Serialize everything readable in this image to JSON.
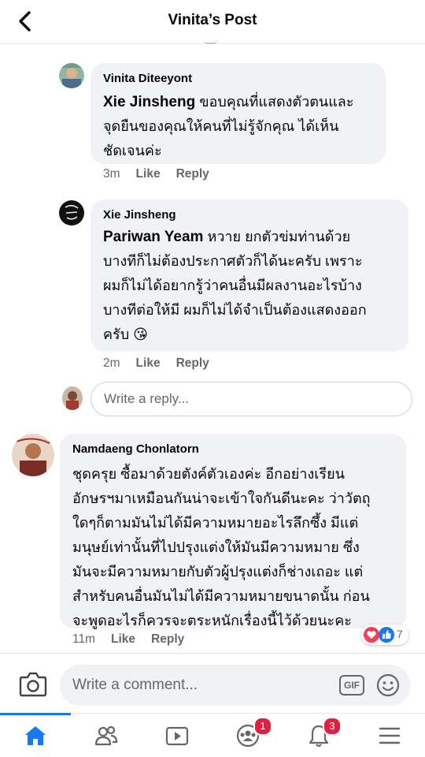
{
  "header": {
    "title": "Vinita’s Post"
  },
  "comments": [
    {
      "author": "Vinita Diteeyont",
      "mention": "Xie Jinsheng",
      "lines": [
        " ขอบคุณที่แสดงตัวตนและ",
        "จุดยืนของคุณให้คนที่ไม่รู้จักคุณ ได้เห็น",
        "ชัดเจนค่ะ"
      ],
      "time": "3m",
      "like": "Like",
      "reply": "Reply"
    },
    {
      "author": "Xie Jinsheng",
      "mention": "Pariwan Yeam",
      "lines": [
        " หวาย ยกตัวข่มท่านด้วย",
        "บางทีก็ไม่ต้องประกาศตัวก็ได้นะครับ เพราะ",
        "ผมก็ไม่ได้อยากรู้ว่าคนอื่นมีผลงานอะไรบ้าง",
        "บางทีต่อให้มี ผมก็ไม่ได้จำเป็นต้องแสดงออก",
        "ครับ 😘"
      ],
      "time": "2m",
      "like": "Like",
      "reply": "Reply"
    },
    {
      "author": "Namdaeng Chonlatorn",
      "lines": [
        "ชุดครุย ซื้อมาด้วยตังค์ตัวเองค่ะ อีกอย่างเรียน",
        "อักษรฯมาเหมือนกันน่าจะเข้าใจกันดีนะคะ ว่าวัตถุ",
        "ใดๆก็ตามมันไม่ได้มีความหมายอะไรลึกซึ้ง มีแต่",
        "มนุษย์เท่านั้นที่ไปปรุงแต่งให้มันมีความหมาย ซึ่ง",
        "มันจะมีความหมายกับตัวผู้ปรุงแต่งก็ช่างเถอะ แต่",
        "สำหรับคนอื่นมันไม่ได้มีความหมายขนาดนั้น ก่อน",
        "จะพูดอะไรก็ควรจะตระหนักเรื่องนี้ไว้ด้วยนะคะ"
      ],
      "time": "11m",
      "like": "Like",
      "reply": "Reply",
      "reaction_count": "7"
    }
  ],
  "reply_box": {
    "placeholder": "Write a reply..."
  },
  "composer": {
    "placeholder": "Write a comment...",
    "gif_label": "GIF"
  },
  "tabs": [
    {
      "name": "home",
      "active": true
    },
    {
      "name": "friends"
    },
    {
      "name": "watch"
    },
    {
      "name": "groups",
      "badge": "1"
    },
    {
      "name": "notifications",
      "badge": "3"
    },
    {
      "name": "menu"
    }
  ],
  "colors": {
    "accent": "#1877f2",
    "badge": "#e41e3f",
    "bubble": "#f0f2f5",
    "meta": "#65676b"
  }
}
